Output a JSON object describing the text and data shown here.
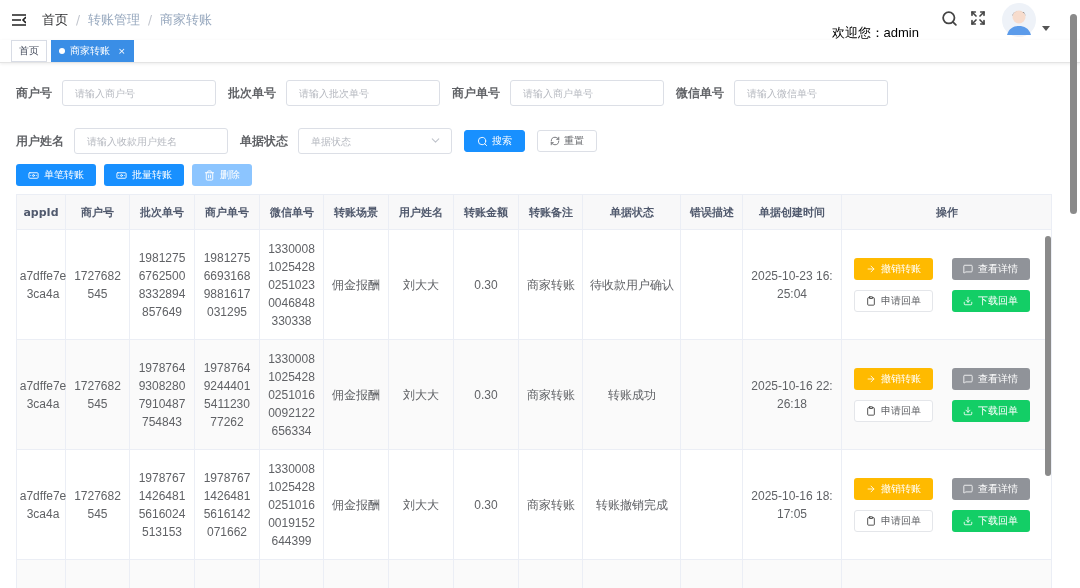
{
  "header": {
    "breadcrumb": [
      "首页",
      "转账管理",
      "商家转账"
    ],
    "separator": "/",
    "welcome": "欢迎您：admin"
  },
  "tabs": [
    {
      "label": "首页",
      "selected": false
    },
    {
      "label": "商家转账",
      "selected": true,
      "close": "×"
    }
  ],
  "filter_rows": [
    [
      {
        "label": "商户号",
        "placeholder": "请输入商户号",
        "kind": "input"
      },
      {
        "label": "批次单号",
        "placeholder": "请输入批次单号",
        "kind": "input"
      },
      {
        "label": "商户单号",
        "placeholder": "请输入商户单号",
        "kind": "input"
      },
      {
        "label": "微信单号",
        "placeholder": "请输入微信单号",
        "kind": "input"
      }
    ],
    [
      {
        "label": "用户姓名",
        "placeholder": "请输入收款用户姓名",
        "kind": "input"
      },
      {
        "label": "单据状态",
        "placeholder": "单据状态",
        "kind": "select"
      }
    ]
  ],
  "search_buttons": [
    {
      "label": "搜索",
      "kind": "primary"
    },
    {
      "label": "重置",
      "kind": "plain"
    }
  ],
  "toolbar": [
    {
      "label": "单笔转账",
      "disabled": false,
      "kind": "money"
    },
    {
      "label": "批量转账",
      "disabled": false,
      "kind": "money"
    },
    {
      "label": "删除",
      "disabled": true,
      "kind": "delete"
    }
  ],
  "table": {
    "columns": [
      "appId",
      "商户号",
      "批次单号",
      "商户单号",
      "微信单号",
      "转账场景",
      "用户姓名",
      "转账金额",
      "转账备注",
      "单据状态",
      "错误描述",
      "单据创建时间",
      "操作"
    ],
    "rows": [
      {
        "cells": [
          "a7dffe7e3ca4a",
          "1727682545",
          "198127567625008332894857649",
          "198127566931689881617031295",
          "1330008102542802510230046848330338",
          "佣金报酬",
          "刘大大",
          "0.30",
          "商家转账",
          "待收款用户确认",
          "",
          "2025-10-23 16:25:04"
        ],
        "actions": [
          {
            "label": "撤销转账",
            "kind": "warning"
          },
          {
            "label": "查看详情",
            "kind": "info"
          },
          {
            "label": "申请回单",
            "kind": "plain"
          },
          {
            "label": "下载回单",
            "kind": "success"
          }
        ]
      },
      {
        "cells": [
          "a7dffe7e3ca4a",
          "1727682545",
          "197876493082807910487754843",
          "19787649244401541123077262",
          "1330008102542802510160092122656334",
          "佣金报酬",
          "刘大大",
          "0.30",
          "商家转账",
          "转账成功",
          "",
          "2025-10-16 22:26:18"
        ],
        "actions": [
          {
            "label": "撤销转账",
            "kind": "warning"
          },
          {
            "label": "查看详情",
            "kind": "info"
          },
          {
            "label": "申请回单",
            "kind": "plain"
          },
          {
            "label": "下载回单",
            "kind": "success"
          }
        ]
      },
      {
        "cells": [
          "a7dffe7e3ca4a",
          "1727682545",
          "197876714264815616024513153",
          "197876714264815616142071662",
          "1330008102542802510160019152644399",
          "佣金报酬",
          "刘大大",
          "0.30",
          "商家转账",
          "转账撤销完成",
          "",
          "2025-10-16 18:17:05"
        ],
        "actions": [
          {
            "label": "撤销转账",
            "kind": "warning"
          },
          {
            "label": "查看详情",
            "kind": "info"
          },
          {
            "label": "申请回单",
            "kind": "plain"
          },
          {
            "label": "下载回单",
            "kind": "success"
          }
        ]
      }
    ]
  }
}
